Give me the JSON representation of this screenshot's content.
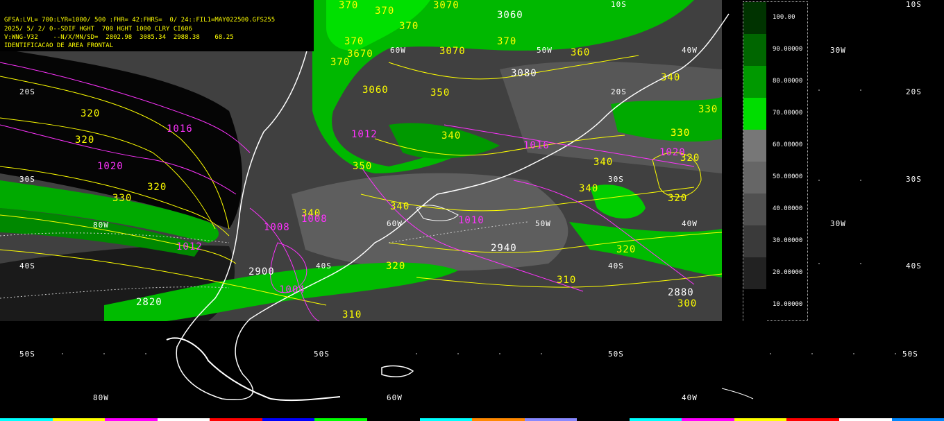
{
  "header": {
    "line1": "GFSA:LVL= 700:LYR=1000/ 500 :FHR= 42:FHRS=  0/ 24::FIL1=MAY022500.GFS255",
    "line2": "2025/ 5/ 2/ 0--SDIF HGHT  700 HGHT 1000 CLRY CI606",
    "line3": "V:WNG-V32    --N/X/MN/SD=  2802.98  3085.34  2988.38    68.25",
    "line4": "IDENTIFICACAO DE AREA FRONTAL"
  },
  "grid_labels": {
    "lat_10s": "10S",
    "lat_20s": "20S",
    "lat_30s": "30S",
    "lat_40s": "40S",
    "lat_50s": "50S",
    "lon_80w": "80W",
    "lon_60w": "60W",
    "lon_50w": "50W",
    "lon_40w": "40W",
    "lon_30w": "30W"
  },
  "legend": {
    "values": [
      "100.00",
      "90.00000",
      "80.00000",
      "70.00000",
      "60.00000",
      "50.00000",
      "40.00000",
      "30.00000",
      "20.00000",
      "10.00000"
    ],
    "colors": [
      "#003300",
      "#006600",
      "#009900",
      "#00dd00",
      "#777777",
      "#666666",
      "#505050",
      "#3a3a3a",
      "#222222",
      "#000000"
    ]
  },
  "contours": {
    "thickness_yellow": [
      "370",
      "370",
      "3070",
      "370",
      "370",
      "3070",
      "370",
      "3670",
      "370",
      "3060",
      "360",
      "350",
      "340",
      "340",
      "330",
      "330",
      "320",
      "320",
      "320",
      "330",
      "320",
      "320",
      "340",
      "350",
      "340",
      "340",
      "340",
      "330",
      "320",
      "310",
      "320",
      "310",
      "300",
      "2940",
      "3060",
      "3080"
    ],
    "pressure_magenta": [
      "1016",
      "1020",
      "1012",
      "1008",
      "1016",
      "1012",
      "1020",
      "1008",
      "1004",
      "1010"
    ],
    "height_white": [
      "2820",
      "2880",
      "2940",
      "2900",
      "3060",
      "3080"
    ]
  },
  "colors": {
    "background": "#000000",
    "header_text": "#ffff00",
    "thickness_contour": "#ffff00",
    "pressure_contour": "#ff33ff",
    "coastline": "#ffffff",
    "front_green": "#00cc00"
  }
}
